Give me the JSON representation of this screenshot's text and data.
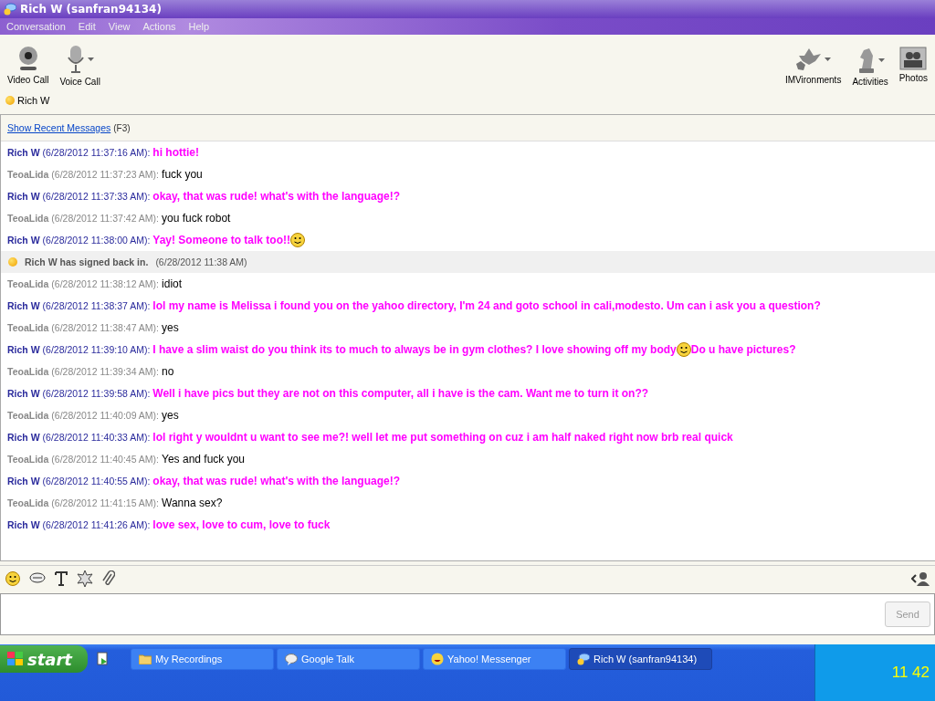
{
  "window": {
    "title": "Rich W (sanfran94134)"
  },
  "menu": [
    "Conversation",
    "Edit",
    "View",
    "Actions",
    "Help"
  ],
  "toolbar_left": [
    {
      "label": "Video Call",
      "kind": "webcam",
      "dropdown": false
    },
    {
      "label": "Voice Call",
      "kind": "mic",
      "dropdown": true
    }
  ],
  "toolbar_right": [
    {
      "label": "IMVironments",
      "kind": "leaves",
      "dropdown": true
    },
    {
      "label": "Activities",
      "kind": "chess",
      "dropdown": true
    },
    {
      "label": "Photos",
      "kind": "photos",
      "dropdown": false
    }
  ],
  "contact": {
    "name": "Rich W"
  },
  "history_link": {
    "label": "Show Recent Messages",
    "shortcut": "(F3)"
  },
  "messages": [
    {
      "kind": "remote",
      "sender": "Rich W",
      "time": "(6/28/2012 11:37:16 AM):",
      "parts": [
        {
          "kind": "text",
          "text": "hi hottie!"
        }
      ]
    },
    {
      "kind": "local",
      "sender": "TeoaLida",
      "time": "(6/28/2012 11:37:23 AM):",
      "parts": [
        {
          "kind": "text",
          "text": "fuck you"
        }
      ]
    },
    {
      "kind": "remote",
      "sender": "Rich W",
      "time": "(6/28/2012 11:37:33 AM):",
      "parts": [
        {
          "kind": "text",
          "text": "okay, that was rude!  what's with the language!?"
        }
      ]
    },
    {
      "kind": "local",
      "sender": "TeoaLida",
      "time": "(6/28/2012 11:37:42 AM):",
      "parts": [
        {
          "kind": "text",
          "text": "you fuck robot"
        }
      ]
    },
    {
      "kind": "remote",
      "sender": "Rich W",
      "time": "(6/28/2012 11:38:00 AM):",
      "parts": [
        {
          "kind": "text",
          "text": "Yay! Someone to talk too!!"
        },
        {
          "kind": "smiley"
        }
      ]
    },
    {
      "kind": "status",
      "text": "Rich W has signed back in.",
      "time": "(6/28/2012 11:38 AM)"
    },
    {
      "kind": "local",
      "sender": "TeoaLida",
      "time": "(6/28/2012 11:38:12 AM):",
      "parts": [
        {
          "kind": "text",
          "text": "idiot"
        }
      ]
    },
    {
      "kind": "remote",
      "sender": "Rich W",
      "time": "(6/28/2012 11:38:37 AM):",
      "parts": [
        {
          "kind": "text",
          "text": "lol my name is Melissa i found you on the yahoo directory, I'm 24 and goto school in cali,modesto.  Um can i ask you a question?"
        }
      ]
    },
    {
      "kind": "local",
      "sender": "TeoaLida",
      "time": "(6/28/2012 11:38:47 AM):",
      "parts": [
        {
          "kind": "text",
          "text": "yes"
        }
      ]
    },
    {
      "kind": "remote",
      "sender": "Rich W",
      "time": "(6/28/2012 11:39:10 AM):",
      "parts": [
        {
          "kind": "text",
          "text": "I have a slim waist do you think its to much to always be in gym clothes?  I love showing off my body"
        },
        {
          "kind": "smiley"
        },
        {
          "kind": "text",
          "text": "Do u have pictures?"
        }
      ]
    },
    {
      "kind": "local",
      "sender": "TeoaLida",
      "time": "(6/28/2012 11:39:34 AM):",
      "parts": [
        {
          "kind": "text",
          "text": "no"
        }
      ]
    },
    {
      "kind": "remote",
      "sender": "Rich W",
      "time": "(6/28/2012 11:39:58 AM):",
      "parts": [
        {
          "kind": "text",
          "text": "Well i have pics but they are not on this computer, all i have is the cam. Want me to turn it on??"
        }
      ]
    },
    {
      "kind": "local",
      "sender": "TeoaLida",
      "time": "(6/28/2012 11:40:09 AM):",
      "parts": [
        {
          "kind": "text",
          "text": "yes"
        }
      ]
    },
    {
      "kind": "remote",
      "sender": "Rich W",
      "time": "(6/28/2012 11:40:33 AM):",
      "parts": [
        {
          "kind": "text",
          "text": "lol right y wouldnt u want to see me?! well let me put something on cuz i am half naked right now brb real quick"
        }
      ]
    },
    {
      "kind": "local",
      "sender": "TeoaLida",
      "time": "(6/28/2012 11:40:45 AM):",
      "parts": [
        {
          "kind": "text",
          "text": "Yes and fuck you"
        }
      ]
    },
    {
      "kind": "remote",
      "sender": "Rich W",
      "time": "(6/28/2012 11:40:55 AM):",
      "parts": [
        {
          "kind": "text",
          "text": "okay, that was rude!  what's with the language!?"
        }
      ]
    },
    {
      "kind": "local",
      "sender": "TeoaLida",
      "time": "(6/28/2012 11:41:15 AM):",
      "parts": [
        {
          "kind": "text",
          "text": "Wanna sex?"
        }
      ]
    },
    {
      "kind": "remote",
      "sender": "Rich W",
      "time": "(6/28/2012 11:41:26 AM):",
      "parts": [
        {
          "kind": "text",
          "text": "love sex, love to cum, love to fuck"
        }
      ]
    }
  ],
  "compose": {
    "send_label": "Send",
    "send_disabled": true
  },
  "taskbar": {
    "start_label": "start",
    "tasks": [
      {
        "label": "My Recordings",
        "kind": "folder",
        "selected": false
      },
      {
        "label": "Google Talk",
        "kind": "bubble",
        "selected": false
      },
      {
        "label": "Yahoo! Messenger",
        "kind": "smiley",
        "selected": false
      },
      {
        "label": "Rich W (sanfran94134)",
        "kind": "messenger",
        "selected": true
      }
    ],
    "clock": "11 42"
  }
}
